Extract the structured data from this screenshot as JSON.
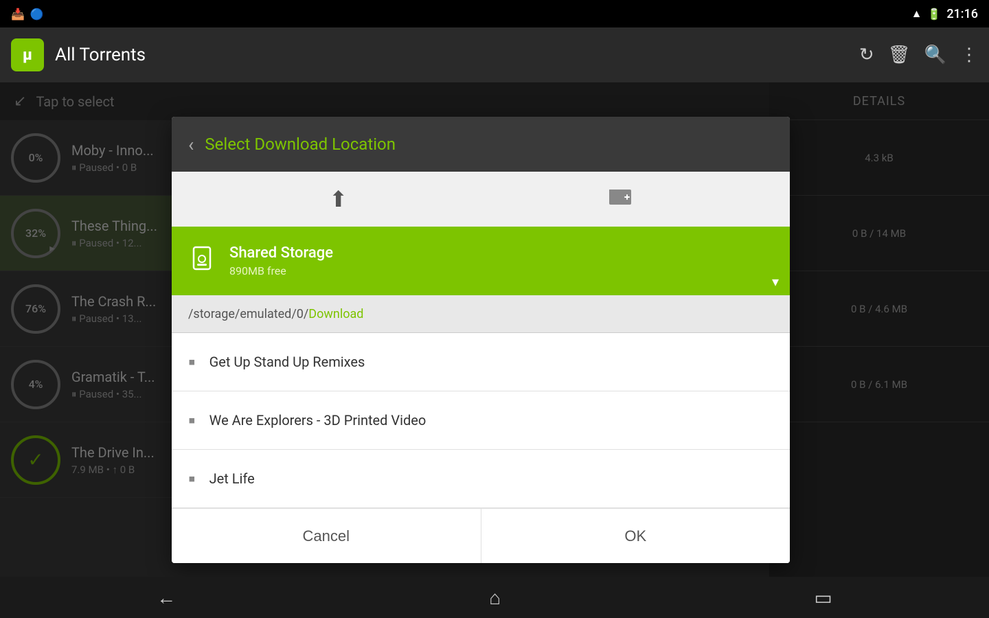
{
  "statusBar": {
    "time": "21:16",
    "wifiIcon": "📶",
    "batteryIcon": "🔋"
  },
  "appBar": {
    "logoText": "μ",
    "title": "All Torrents",
    "refreshIcon": "↻",
    "deleteIcon": "🗑",
    "searchIcon": "🔍",
    "moreIcon": "⋮"
  },
  "selectBar": {
    "text": "Tap to select"
  },
  "torrents": [
    {
      "name": "Moby - Inno...",
      "status": "⏸ Paused • 0 B",
      "progress": "0%",
      "size": ""
    },
    {
      "name": "These Thing...",
      "status": "⏸ Paused • 12...",
      "progress": "32%",
      "size": "4.3 kB"
    },
    {
      "name": "The Crash R...",
      "status": "⏸ Paused • 13...",
      "progress": "76%",
      "size": "0 B / 14 MB"
    },
    {
      "name": "Gramatik - T...",
      "status": "⏸ Paused • 35...",
      "progress": "4%",
      "size": "0 B / 4.6 MB"
    },
    {
      "name": "The Drive In...",
      "status": "7.9 MB • ↑ 0 B",
      "progress": "✓",
      "size": "0 B / 6.1 MB"
    }
  ],
  "detailsPanel": {
    "header": "DETAILS",
    "rows": [
      "4.3 kB",
      "0 B / 14 MB",
      "0 B / 4.6 MB",
      "0 B / 6.1 MB"
    ]
  },
  "dialog": {
    "title": "Select Download Location",
    "backIcon": "‹",
    "upIcon": "⬆",
    "newFolderIcon": "📁",
    "storage": {
      "name": "Shared Storage",
      "free": "890MB free",
      "icon": "📱"
    },
    "currentPath": "/storage/emulated/0/",
    "currentFolder": "Download",
    "folders": [
      "Get Up Stand Up Remixes",
      "We Are Explorers - 3D Printed Video",
      "Jet Life"
    ],
    "cancelLabel": "Cancel",
    "okLabel": "OK"
  },
  "bottomNav": {
    "backIcon": "←",
    "homeIcon": "⌂",
    "recentIcon": "▭"
  }
}
